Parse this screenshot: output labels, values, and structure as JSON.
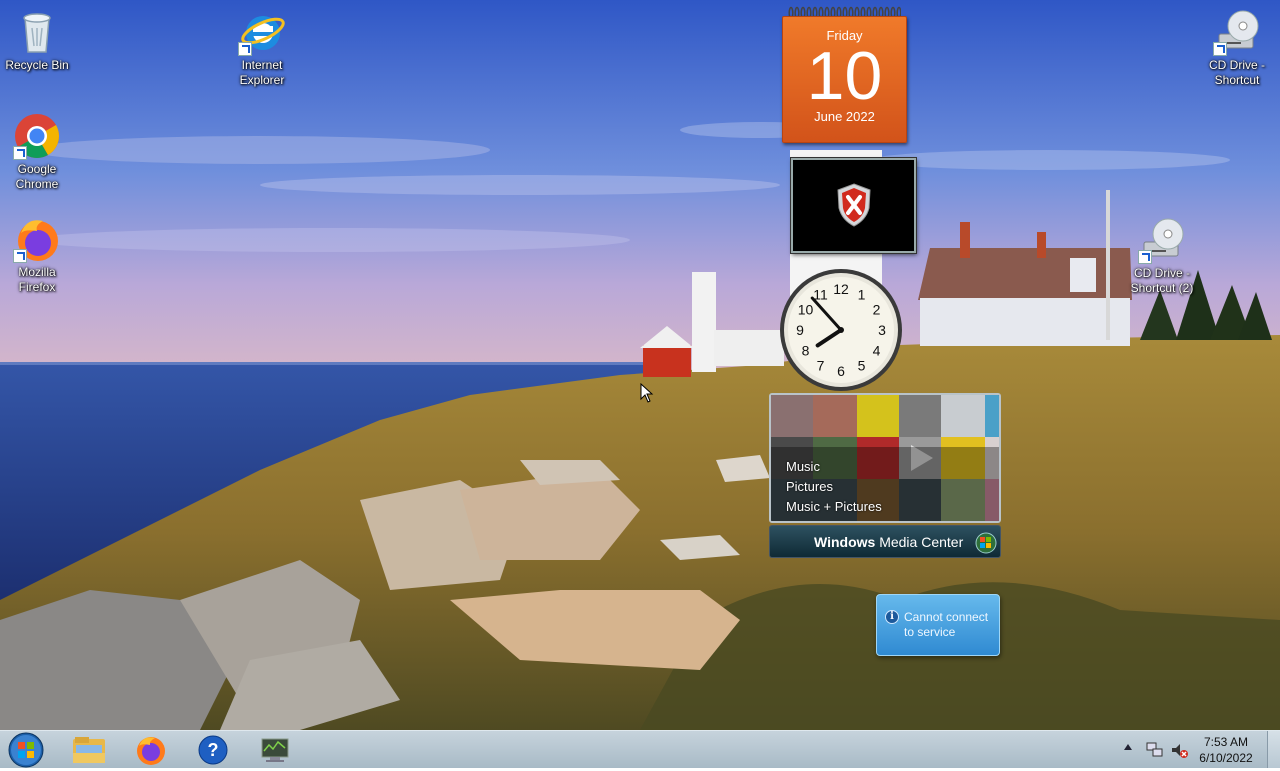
{
  "desktop": {
    "icons": [
      {
        "label": "Recycle Bin",
        "icon": "recycle-bin-icon"
      },
      {
        "label": "Internet Explorer",
        "icon": "internet-explorer-icon"
      },
      {
        "label": "Google Chrome",
        "icon": "chrome-icon"
      },
      {
        "label": "Mozilla Firefox",
        "icon": "firefox-icon"
      },
      {
        "label": "CD Drive - Shortcut",
        "icon": "cd-drive-icon"
      },
      {
        "label": "CD Drive - Shortcut (2)",
        "icon": "cd-drive-icon"
      }
    ]
  },
  "gadgets": {
    "calendar": {
      "day": "Friday",
      "date": "10",
      "month": "June 2022"
    },
    "security": {
      "icon": "security-shield-error-icon"
    },
    "clock": {
      "hour": 7,
      "minute": 53
    },
    "media_center": {
      "menu": [
        "Music",
        "Pictures",
        "Music + Pictures"
      ],
      "brand_light": "Windows",
      "brand_rest": " Media Center"
    },
    "info": {
      "message": "Cannot connect to service"
    }
  },
  "taskbar": {
    "pinned": [
      {
        "icon": "file-explorer-icon"
      },
      {
        "icon": "firefox-icon"
      },
      {
        "icon": "help-icon"
      },
      {
        "icon": "monitor-icon"
      }
    ],
    "tray": {
      "time": "7:53 AM",
      "date": "6/10/2022"
    }
  },
  "colors": {
    "calendar_orange": "#e8662a",
    "taskbar": "#b8c8d3",
    "info_blue": "#3f97d8"
  }
}
